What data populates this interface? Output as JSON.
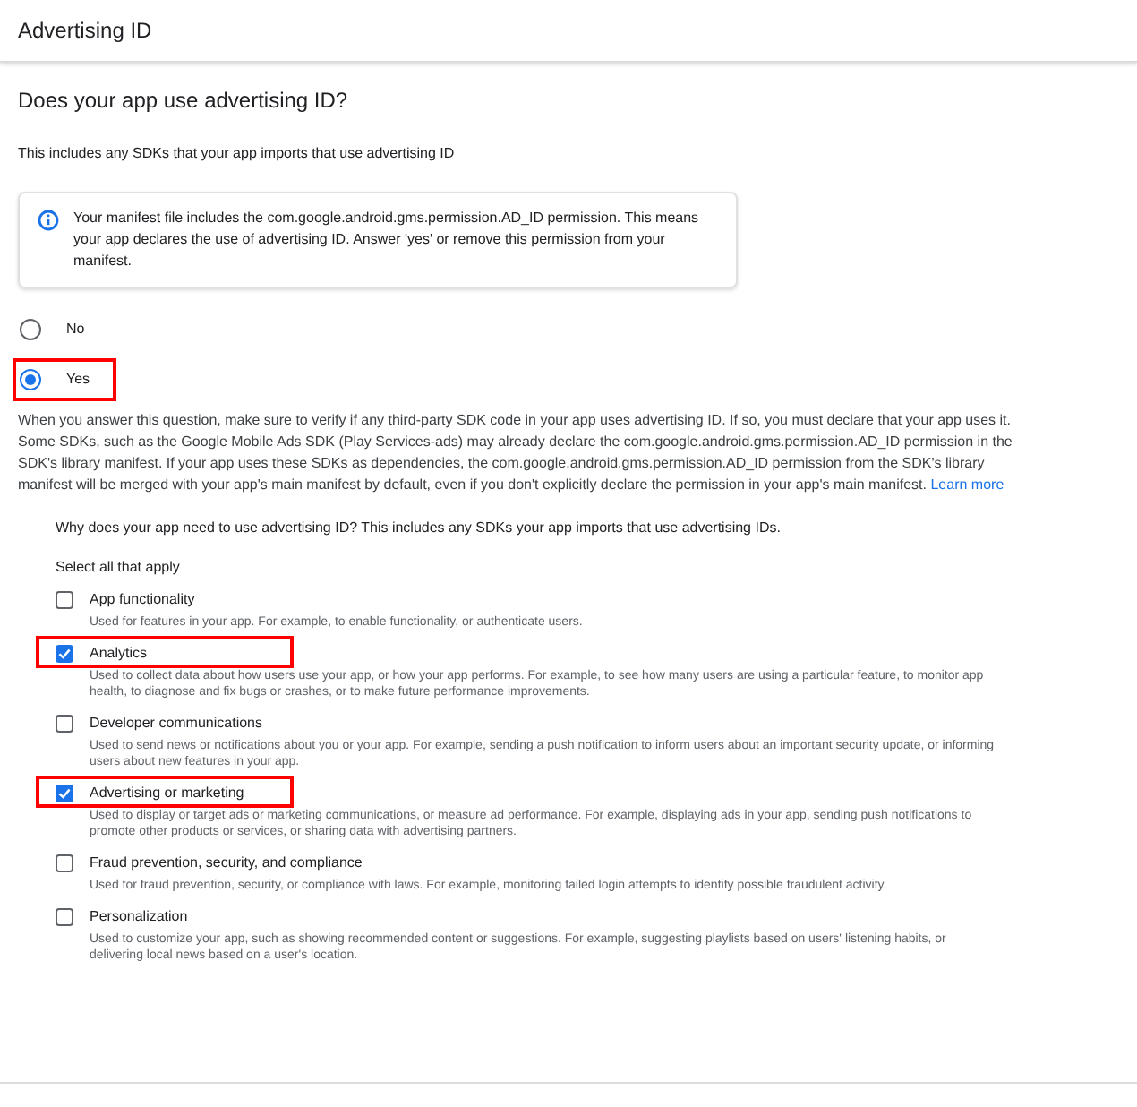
{
  "header": {
    "title": "Advertising ID"
  },
  "question": {
    "title": "Does your app use advertising ID?",
    "subtitle": "This includes any SDKs that your app imports that use advertising ID"
  },
  "notice": {
    "text": "Your manifest file includes the com.google.android.gms.permission.AD_ID permission. This means your app declares the use of advertising ID. Answer 'yes' or remove this permission from your manifest."
  },
  "answers": [
    {
      "label": "No",
      "selected": false,
      "highlighted": false
    },
    {
      "label": "Yes",
      "selected": true,
      "highlighted": true
    }
  ],
  "explanation": {
    "text": "When you answer this question, make sure to verify if any third-party SDK code in your app uses advertising ID. If so, you must declare that your app uses it. Some SDKs, such as the Google Mobile Ads SDK (Play Services-ads) may already declare the com.google.android.gms.permission.AD_ID permission in the SDK's library manifest. If your app uses these SDKs as dependencies, the com.google.android.gms.permission.AD_ID permission from the SDK's library manifest will be merged with your app's main manifest by default, even if you don't explicitly declare the permission in your app's main manifest.",
    "link": "Learn more"
  },
  "purposes": {
    "prompt": "Why does your app need to use advertising ID? This includes any SDKs your app imports that use advertising IDs.",
    "hint": "Select all that apply",
    "items": [
      {
        "label": "App functionality",
        "description": "Used for features in your app. For example, to enable functionality, or authenticate users.",
        "checked": false,
        "highlighted": false
      },
      {
        "label": "Analytics",
        "description": "Used to collect data about how users use your app, or how your app performs. For example, to see how many users are using a particular feature, to monitor app health, to diagnose and fix bugs or crashes, or to make future performance improvements.",
        "checked": true,
        "highlighted": true
      },
      {
        "label": "Developer communications",
        "description": "Used to send news or notifications about you or your app. For example, sending a push notification to inform users about an important security update, or informing users about new features in your app.",
        "checked": false,
        "highlighted": false
      },
      {
        "label": "Advertising or marketing",
        "description": "Used to display or target ads or marketing communications, or measure ad performance. For example, displaying ads in your app, sending push notifications to promote other products or services, or sharing data with advertising partners.",
        "checked": true,
        "highlighted": true
      },
      {
        "label": "Fraud prevention, security, and compliance",
        "description": "Used for fraud prevention, security, or compliance with laws. For example, monitoring failed login attempts to identify possible fraudulent activity.",
        "checked": false,
        "highlighted": false
      },
      {
        "label": "Personalization",
        "description": "Used to customize your app, such as showing recommended content or suggestions. For example, suggesting playlists based on users' listening habits, or delivering local news based on a user's location.",
        "checked": false,
        "highlighted": false
      }
    ]
  }
}
